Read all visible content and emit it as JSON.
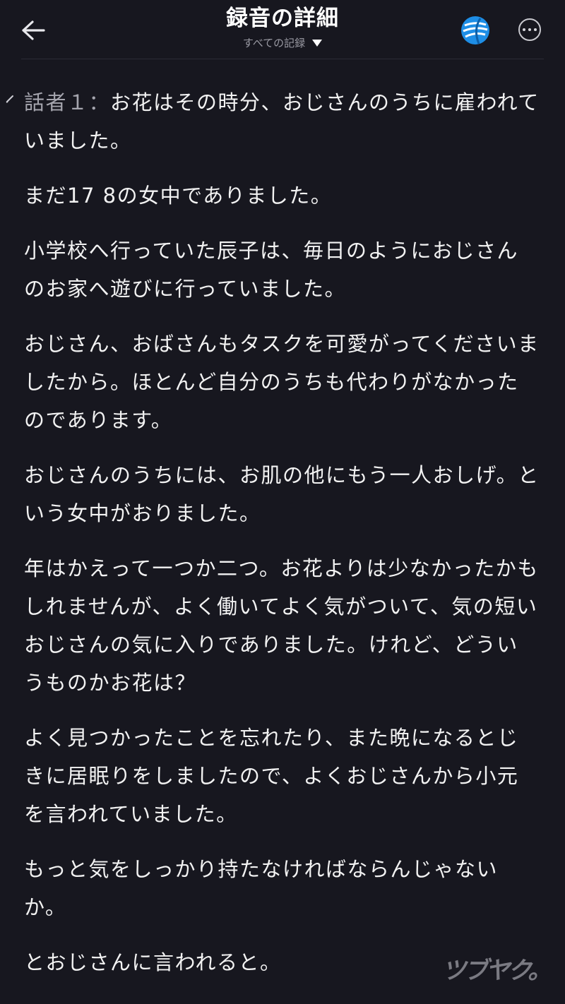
{
  "header": {
    "title": "録音の詳細",
    "filter_label": "すべての記録"
  },
  "transcript": {
    "speaker": "話者１：",
    "paragraphs": [
      "お花はその時分、おじさんのうちに雇われていました。",
      "まだ17 8の女中でありました。",
      "小学校へ行っていた辰子は、毎日のようにおじさんのお家へ遊びに行っていました。",
      "おじさん、おばさんもタスクを可愛がってくださいましたから。ほとんど自分のうちも代わりがなかったのであります。",
      "おじさんのうちには、お肌の他にもう一人おしげ。という女中がおりました。",
      "年はかえって一つか二つ。お花よりは少なかったかもしれませんが、よく働いてよく気がついて、気の短いおじさんの気に入りでありました。けれど、どういうものかお花は？",
      "よく見つかったことを忘れたり、また晩になるとじきに居眠りをしましたので、よくおじさんから小元を言われていました。",
      "もっと気をしっかり持たなければならんじゃないか。",
      "とおじさんに言われると。"
    ]
  },
  "watermark": "ツブヤク。",
  "icons": {
    "back": "back-arrow-icon",
    "dropdown": "caret-down-icon",
    "avatar": "globe-avatar-icon",
    "more": "more-options-icon",
    "edit": "pencil-icon"
  },
  "colors": {
    "background": "#17171f",
    "text": "#f2f2f2",
    "speaker": "#a5a5ae",
    "avatar_blue": "#1e8ee6"
  }
}
